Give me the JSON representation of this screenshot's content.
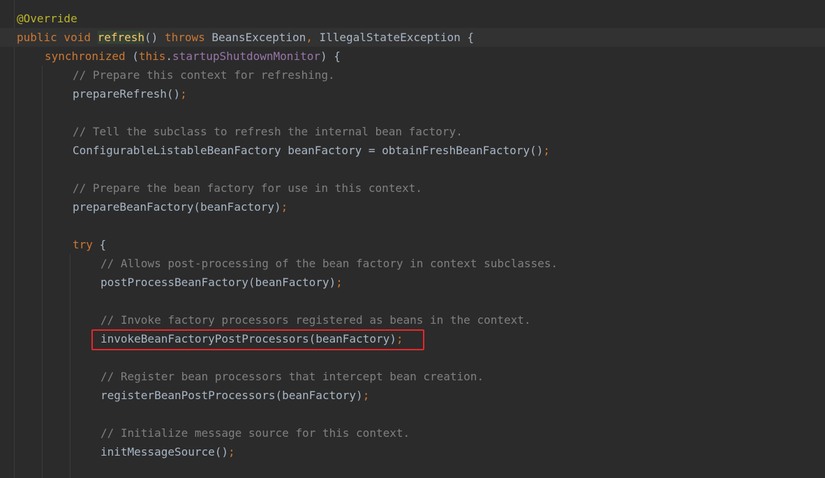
{
  "editor": {
    "lines": [
      {
        "id": "l1",
        "tokens": [
          [
            "ann",
            "@Override"
          ]
        ]
      },
      {
        "id": "l2",
        "tokens": [
          [
            "kw",
            "public void "
          ],
          [
            "hl",
            "refresh"
          ],
          [
            "pl",
            "() "
          ],
          [
            "kw",
            "throws "
          ],
          [
            "pl",
            "BeansException"
          ],
          [
            "kw",
            ", "
          ],
          [
            "pl",
            "IllegalStateException {"
          ]
        ]
      },
      {
        "id": "l3",
        "tokens": [
          [
            "kw",
            "synchronized "
          ],
          [
            "pl",
            "("
          ],
          [
            "kw",
            "this"
          ],
          [
            "pl",
            "."
          ],
          [
            "fld",
            "startupShutdownMonitor"
          ],
          [
            "pl",
            ") {"
          ]
        ]
      },
      {
        "id": "l4",
        "tokens": [
          [
            "cm",
            "// Prepare this context for refreshing."
          ]
        ]
      },
      {
        "id": "l5",
        "tokens": [
          [
            "pl",
            "prepareRefresh()"
          ],
          [
            "kw",
            ";"
          ]
        ]
      },
      {
        "id": "l6",
        "tokens": []
      },
      {
        "id": "l7",
        "tokens": [
          [
            "cm",
            "// Tell the subclass to refresh the internal bean factory."
          ]
        ]
      },
      {
        "id": "l8",
        "tokens": [
          [
            "pl",
            "ConfigurableListableBeanFactory beanFactory = obtainFreshBeanFactory()"
          ],
          [
            "kw",
            ";"
          ]
        ]
      },
      {
        "id": "l9",
        "tokens": []
      },
      {
        "id": "l10",
        "tokens": [
          [
            "cm",
            "// Prepare the bean factory for use in this context."
          ]
        ]
      },
      {
        "id": "l11",
        "tokens": [
          [
            "pl",
            "prepareBeanFactory(beanFactory)"
          ],
          [
            "kw",
            ";"
          ]
        ]
      },
      {
        "id": "l12",
        "tokens": []
      },
      {
        "id": "l13",
        "tokens": [
          [
            "kw",
            "try "
          ],
          [
            "pl",
            "{"
          ]
        ]
      },
      {
        "id": "l14",
        "tokens": [
          [
            "cm",
            "// Allows post-processing of the bean factory in context subclasses."
          ]
        ]
      },
      {
        "id": "l15",
        "tokens": [
          [
            "pl",
            "postProcessBeanFactory(beanFactory)"
          ],
          [
            "kw",
            ";"
          ]
        ]
      },
      {
        "id": "l16",
        "tokens": []
      },
      {
        "id": "l17",
        "tokens": [
          [
            "cm",
            "// Invoke factory processors registered as beans in the context."
          ]
        ]
      },
      {
        "id": "l18",
        "tokens": [
          [
            "pl",
            "invokeBeanFactoryPostProcessors(beanFactory)"
          ],
          [
            "kw",
            ";"
          ]
        ]
      },
      {
        "id": "l19",
        "tokens": []
      },
      {
        "id": "l20",
        "tokens": [
          [
            "cm",
            "// Register bean processors that intercept bean creation."
          ]
        ]
      },
      {
        "id": "l21",
        "tokens": [
          [
            "pl",
            "registerBeanPostProcessors(beanFactory)"
          ],
          [
            "kw",
            ";"
          ]
        ]
      },
      {
        "id": "l22",
        "tokens": []
      },
      {
        "id": "l23",
        "tokens": [
          [
            "cm",
            "// Initialize message source for this context."
          ]
        ]
      },
      {
        "id": "l24",
        "tokens": [
          [
            "pl",
            "initMessageSource()"
          ],
          [
            "kw",
            ";"
          ]
        ]
      }
    ]
  }
}
